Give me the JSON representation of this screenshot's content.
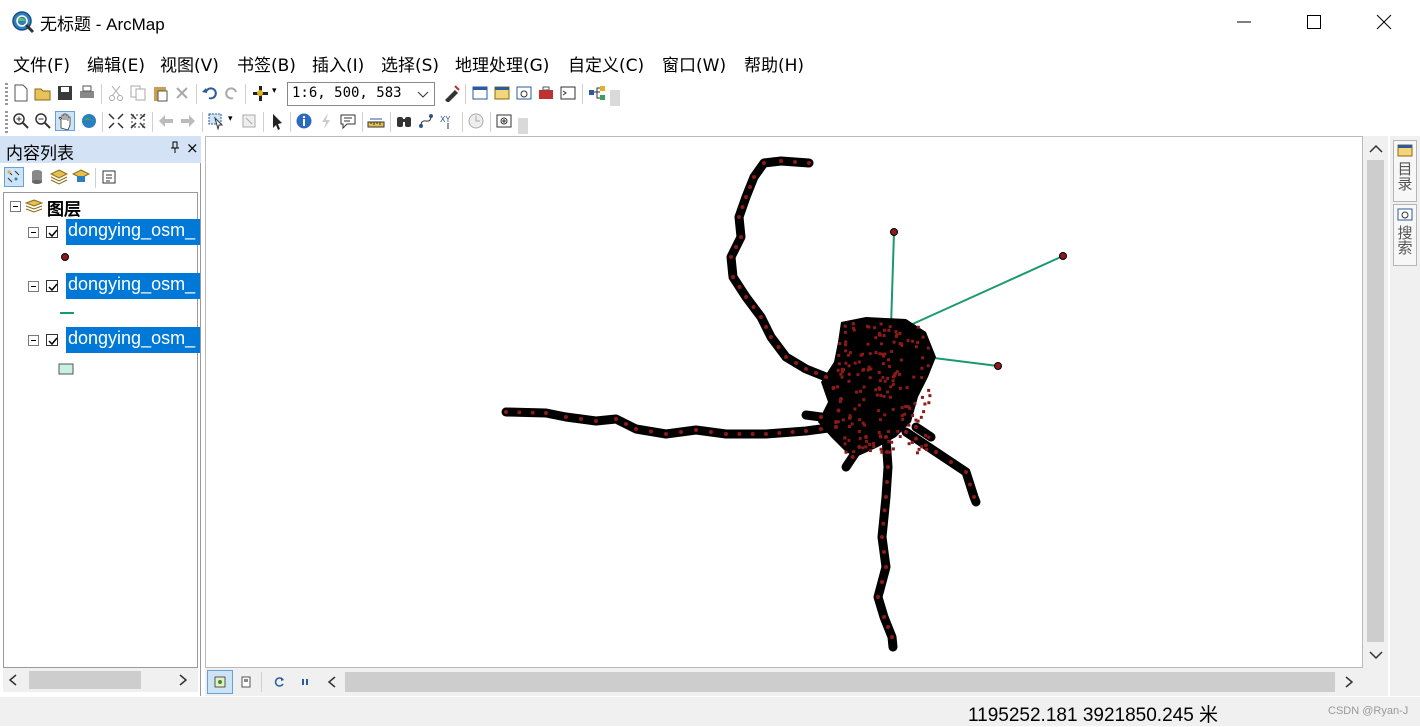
{
  "window": {
    "title": "无标题 - ArcMap",
    "controls": {
      "minimize": "minimize",
      "maximize": "maximize",
      "close": "close"
    }
  },
  "menu": [
    "文件(F)",
    "编辑(E)",
    "视图(V)",
    "书签(B)",
    "插入(I)",
    "选择(S)",
    "地理处理(G)",
    "自定义(C)",
    "窗口(W)",
    "帮助(H)"
  ],
  "standard_toolbar": {
    "scale": "1:6, 500, 583",
    "icons": [
      "new-document-icon",
      "open-icon",
      "save-icon",
      "print-icon",
      "cut-icon",
      "copy-icon",
      "paste-icon",
      "delete-icon",
      "undo-icon",
      "redo-icon",
      "add-data-icon",
      "editor-toolbar-icon",
      "table-of-contents-icon",
      "catalog-window-icon",
      "search-window-icon",
      "arctoolbox-icon",
      "python-window-icon",
      "model-builder-icon"
    ]
  },
  "tools_toolbar": {
    "icons": [
      "zoom-in-icon",
      "zoom-out-icon",
      "pan-icon",
      "full-extent-icon",
      "fixed-zoom-in-icon",
      "fixed-zoom-out-icon",
      "back-extent-icon",
      "forward-extent-icon",
      "select-features-icon",
      "clear-selection-icon",
      "select-elements-icon",
      "identify-icon",
      "hyperlink-icon",
      "html-popup-icon",
      "measure-icon",
      "find-icon",
      "find-route-icon",
      "go-to-xy-icon",
      "time-slider-icon",
      "viewer-window-icon"
    ]
  },
  "toc": {
    "title": "内容列表",
    "pin": "ᵖ",
    "close": "×",
    "tool_icons": [
      "list-by-drawing-order-icon",
      "list-by-source-icon",
      "list-by-visibility-icon",
      "list-by-selection-icon",
      "options-icon"
    ],
    "group": {
      "label": "图层",
      "expanded": true
    },
    "layers": [
      {
        "name": "dongying_osm_",
        "checked": true,
        "symbol": "point",
        "color": "#8b1a1a"
      },
      {
        "name": "dongying_osm_",
        "checked": true,
        "symbol": "line",
        "color": "#1a9a6c"
      },
      {
        "name": "dongying_osm_",
        "checked": true,
        "symbol": "polygon",
        "color": "#c9f0e0"
      }
    ]
  },
  "map": {
    "layout_view_icons": [
      "data-view-icon",
      "layout-view-icon",
      "refresh-icon",
      "pause-drawing-icon"
    ],
    "point_color": "#8b1a1a",
    "line_color": "#1a9a6c",
    "outline_color": "#000000"
  },
  "side_tabs": [
    "目录",
    "搜索"
  ],
  "status": {
    "coordinates": "1195252.181  3921850.245 米",
    "watermark": "CSDN @Ryan-J"
  }
}
